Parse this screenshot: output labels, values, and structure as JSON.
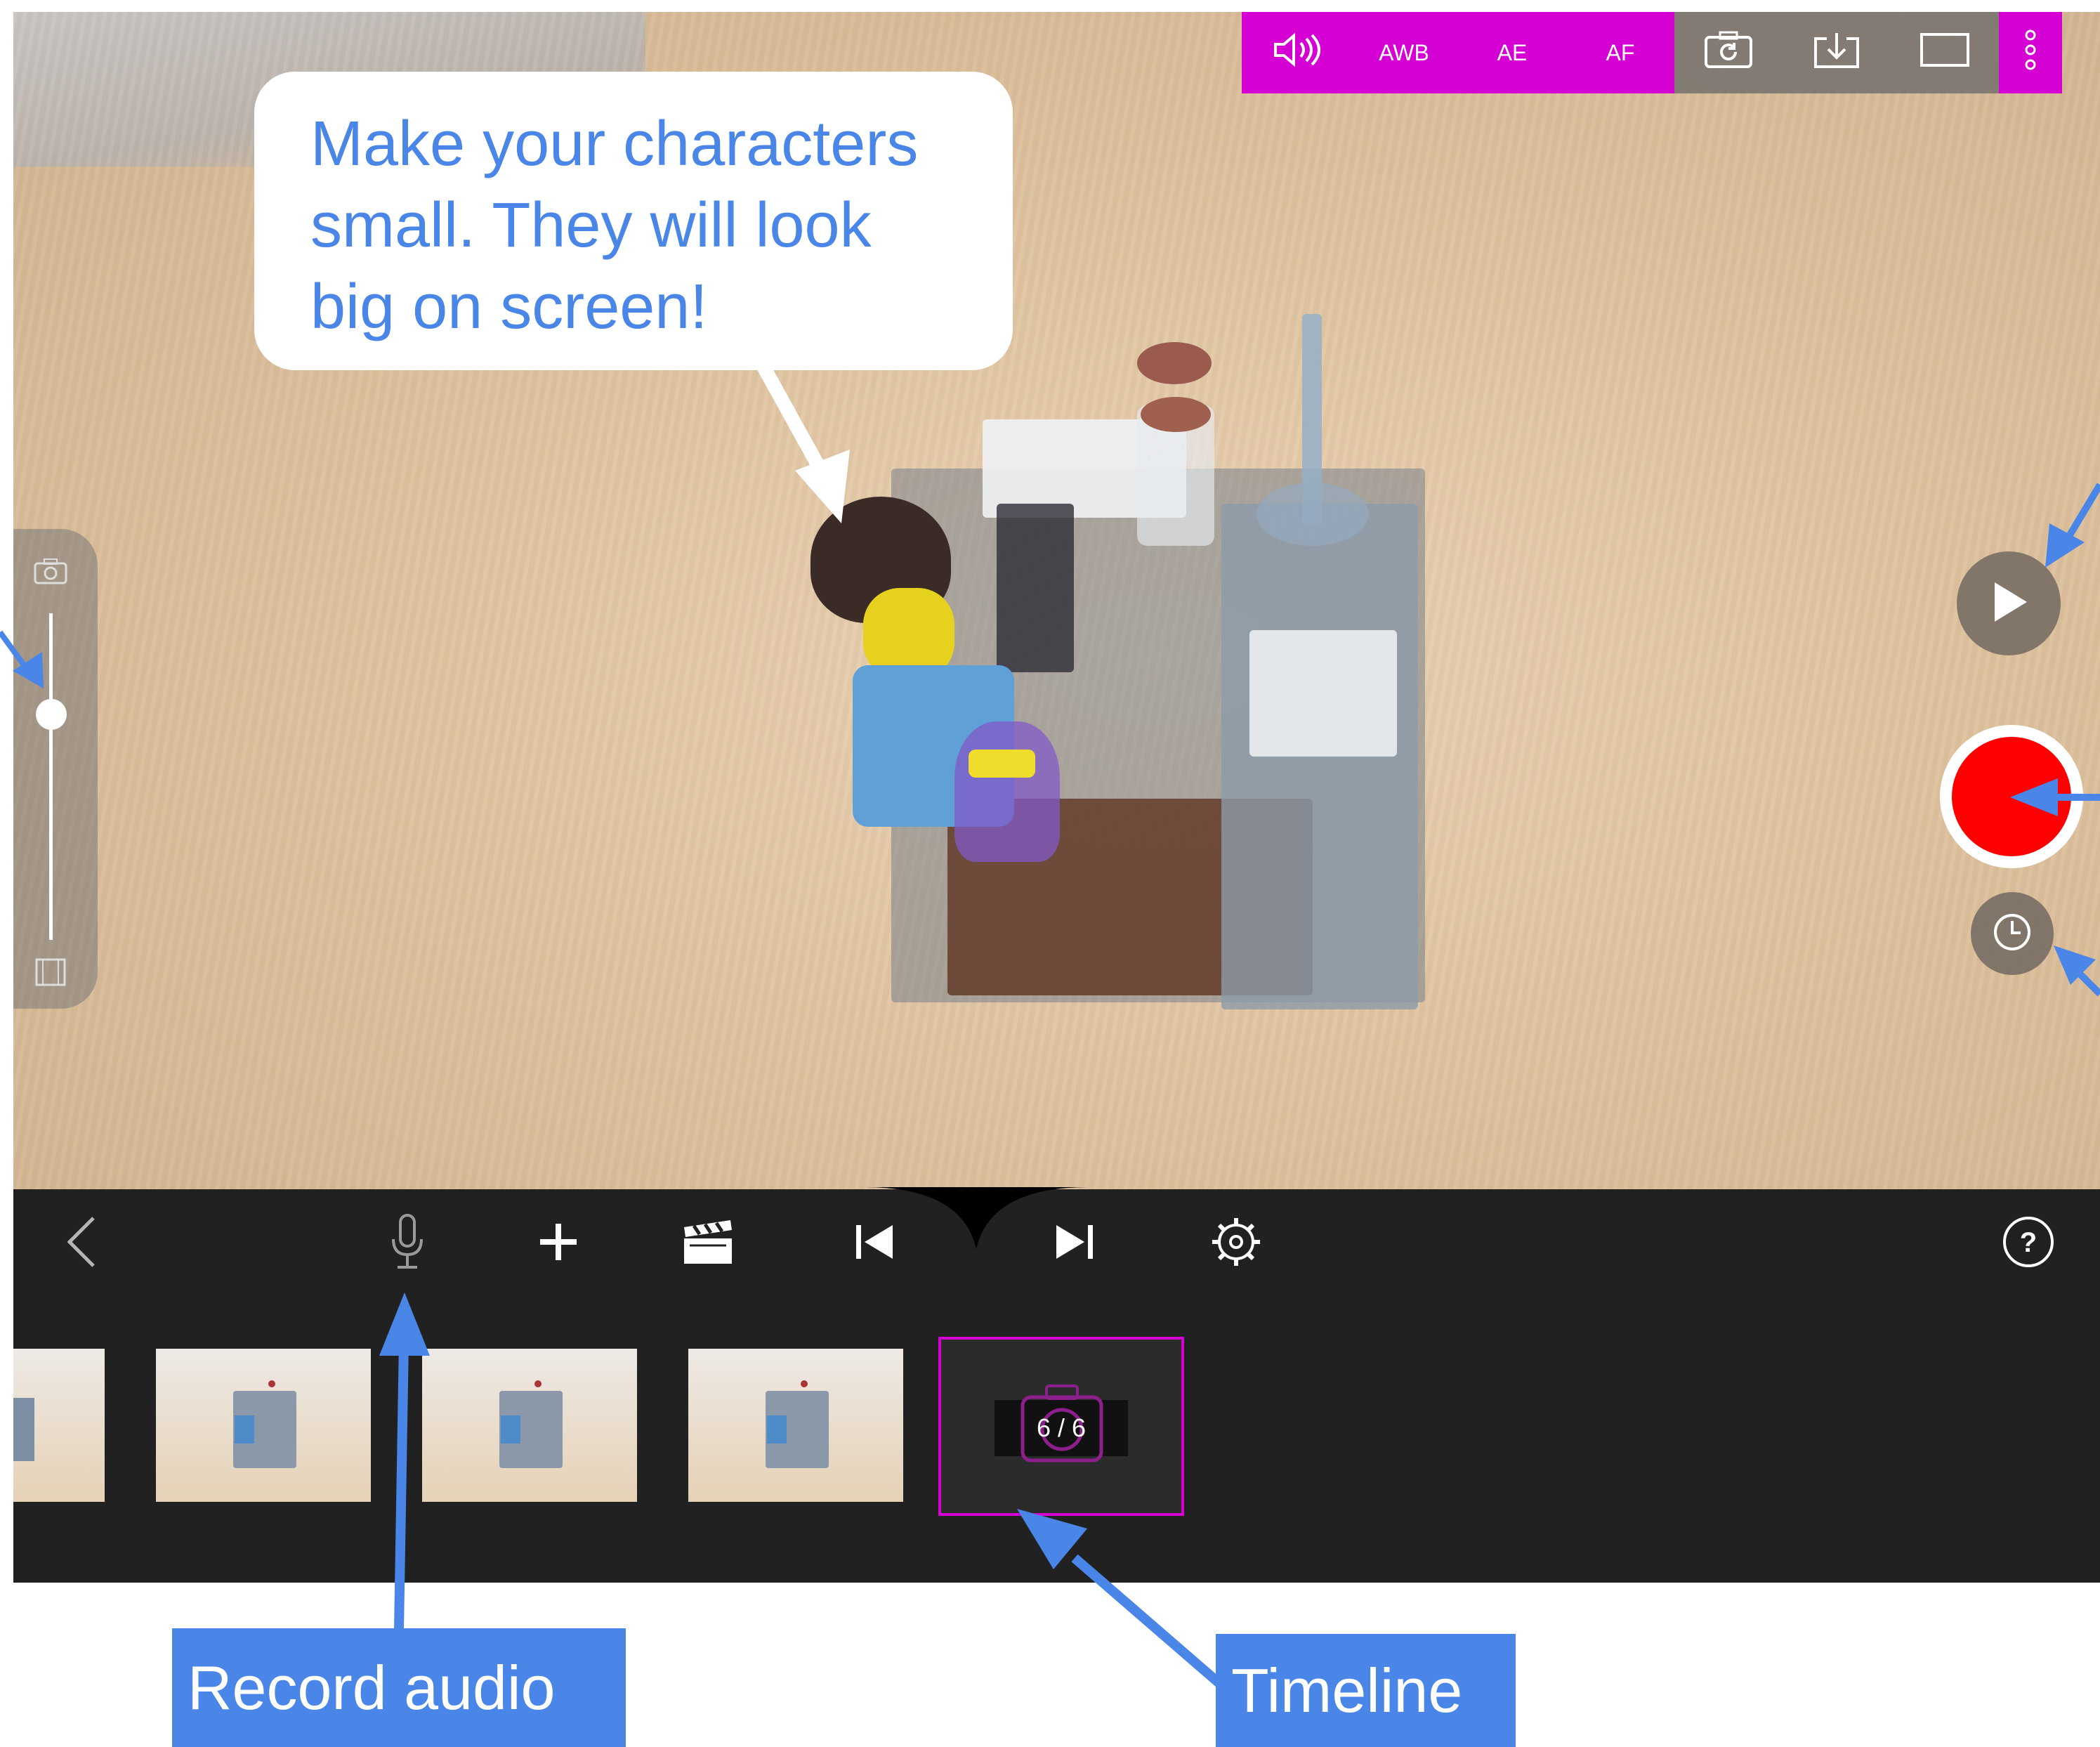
{
  "speech_bubble": {
    "line1": "Make your characters",
    "line2": "small. They will look",
    "line3": "big on screen!"
  },
  "camera_toolbar": {
    "sound_icon": "speaker-icon",
    "awb": "AWB",
    "ae": "AE",
    "af": "AF",
    "rotate_icon": "camera-rotate-icon",
    "import_icon": "import-icon",
    "aspect_icon": "aspect-ratio-icon",
    "more_icon": "more-vertical-icon"
  },
  "timeline": {
    "frame_counter": "6 / 6",
    "thumbnail_count_visible": 4
  },
  "callouts": {
    "record_audio": "Record audio",
    "timeline": "Timeline"
  },
  "colors": {
    "toolbar_magenta": "#d400d4",
    "record_red": "#ff0000",
    "callout_blue": "#4a86e8",
    "bar_dark": "#212121",
    "selection_magenta": "#d400d4"
  }
}
